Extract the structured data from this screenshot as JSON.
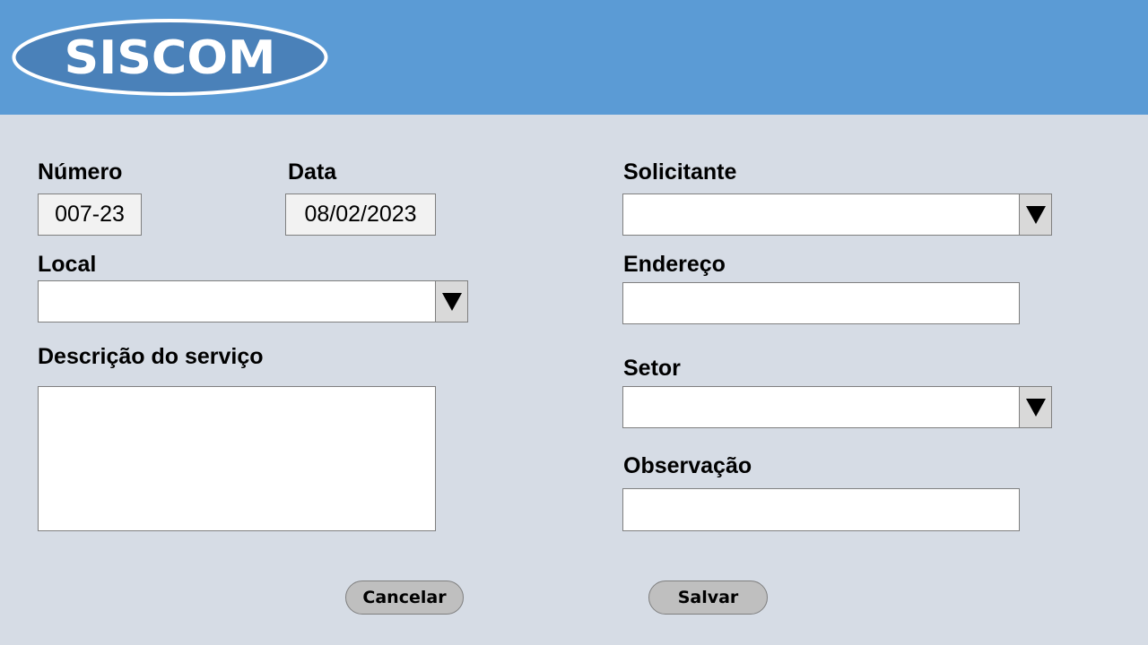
{
  "app": {
    "logo_text": "SISCOM",
    "colors": {
      "header": "#5b9bd5",
      "logo_fill": "#4a81b9",
      "background": "#d6dce5",
      "button": "#bfbfbf"
    }
  },
  "form": {
    "numero": {
      "label": "Número",
      "value": "007-23"
    },
    "data": {
      "label": "Data",
      "value": "08/02/2023"
    },
    "local": {
      "label": "Local",
      "value": ""
    },
    "descricao": {
      "label": "Descrição do serviço",
      "value": ""
    },
    "solicitante": {
      "label": "Solicitante",
      "value": ""
    },
    "endereco": {
      "label": "Endereço",
      "value": ""
    },
    "setor": {
      "label": "Setor",
      "value": ""
    },
    "observacao": {
      "label": "Observação",
      "value": ""
    }
  },
  "actions": {
    "cancel_label": "Cancelar",
    "save_label": "Salvar"
  },
  "icons": {
    "dropdown": "triangle-down-icon"
  }
}
